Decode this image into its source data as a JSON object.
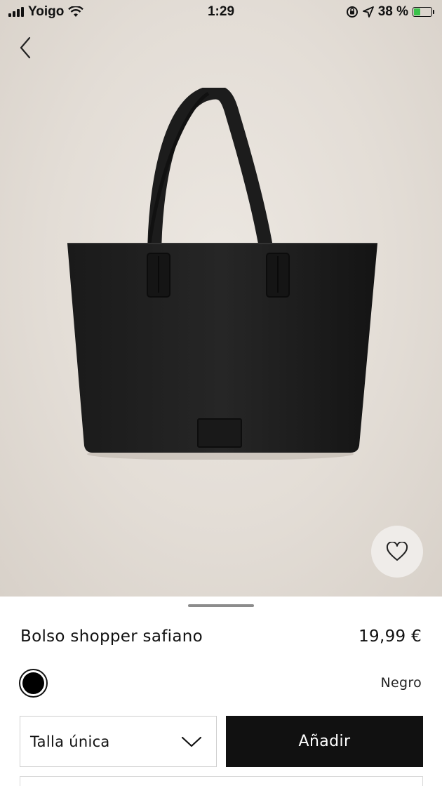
{
  "status_bar": {
    "carrier": "Yoigo",
    "time": "1:29",
    "battery": "38 %",
    "battery_level": 0.38
  },
  "product": {
    "name": "Bolso shopper safiano",
    "price": "19,99 €",
    "color_name": "Negro",
    "color_hex": "#000000",
    "size_selected": "Talla única",
    "add_label": "Añadir"
  },
  "icons": {
    "back": "chevron-left-icon",
    "favorite": "heart-icon",
    "size_dropdown": "chevron-down-icon"
  },
  "colors": {
    "accent": "#111111",
    "image_background": "#e3ddd6",
    "battery_charging": "#3ac24b"
  }
}
